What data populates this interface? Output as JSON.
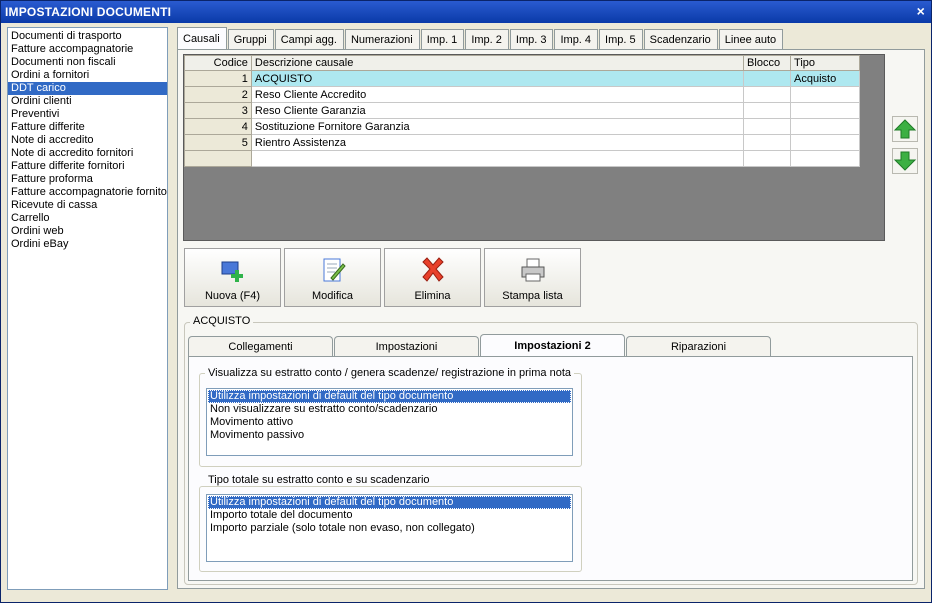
{
  "window": {
    "title": "IMPOSTAZIONI DOCUMENTI",
    "close": "×"
  },
  "doc_list": {
    "items": [
      "Documenti di trasporto",
      "Fatture accompagnatorie",
      "Documenti non fiscali",
      "Ordini a fornitori",
      "DDT carico",
      "Ordini clienti",
      "Preventivi",
      "Fatture differite",
      "Note di accredito",
      "Note di accredito fornitori",
      "Fatture differite fornitori",
      "Fatture proforma",
      "Fatture accompagnatorie fornito",
      "Ricevute di cassa",
      "Carrello",
      "Ordini web",
      "Ordini eBay"
    ],
    "selected_index": 4
  },
  "tabs": [
    "Causali",
    "Gruppi",
    "Campi agg.",
    "Numerazioni",
    "Imp. 1",
    "Imp. 2",
    "Imp. 3",
    "Imp. 4",
    "Imp. 5",
    "Scadenzario",
    "Linee auto"
  ],
  "active_tab": 0,
  "grid": {
    "columns": [
      "Codice",
      "Descrizione causale",
      "Blocco",
      "Tipo"
    ],
    "rows": [
      {
        "codice": "1",
        "descrizione": "ACQUISTO",
        "blocco": "",
        "tipo": "Acquisto"
      },
      {
        "codice": "2",
        "descrizione": "Reso Cliente Accredito",
        "blocco": "",
        "tipo": ""
      },
      {
        "codice": "3",
        "descrizione": "Reso Cliente Garanzia",
        "blocco": "",
        "tipo": ""
      },
      {
        "codice": "4",
        "descrizione": "Sostituzione Fornitore Garanzia",
        "blocco": "",
        "tipo": ""
      },
      {
        "codice": "5",
        "descrizione": "Rientro Assistenza",
        "blocco": "",
        "tipo": ""
      }
    ],
    "selected_row": 0
  },
  "buttons": {
    "new": "Nuova (F4)",
    "edit": "Modifica",
    "delete": "Elimina",
    "print": "Stampa lista"
  },
  "detail": {
    "group_title": "ACQUISTO",
    "tabs": [
      "Collegamenti",
      "Impostazioni",
      "Impostazioni 2",
      "Riparazioni"
    ],
    "active_tab": 2,
    "fieldset1": {
      "legend": "Visualizza su estratto conto / genera scadenze/ registrazione  in prima nota",
      "options": [
        "Utilizza impostazioni di default del tipo documento",
        "Non visualizzare su estratto conto/scadenzario",
        "Movimento attivo",
        "Movimento passivo"
      ],
      "selected": 0
    },
    "fieldset2": {
      "legend": "Tipo totale su estratto conto e su scadenzario",
      "options": [
        "Utilizza impostazioni di default del tipo documento",
        "Importo totale del documento",
        "Importo parziale (solo totale non evaso, non collegato)"
      ],
      "selected": 0
    }
  },
  "colors": {
    "selection": "#316ac5",
    "row_highlight": "#aee8f0",
    "arrow_green": "#3cb043"
  }
}
